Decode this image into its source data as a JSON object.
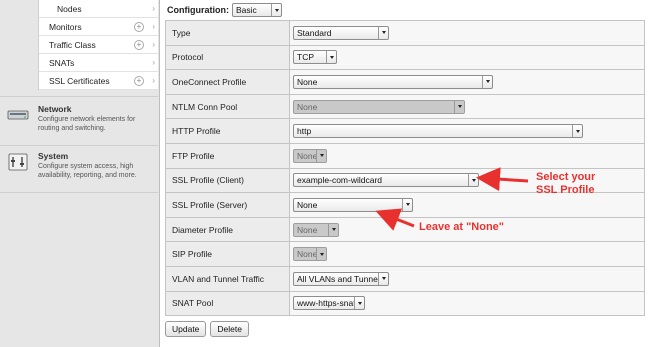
{
  "sidebar": {
    "submenu": [
      {
        "label": "Nodes",
        "indented": true,
        "has_add": false
      },
      {
        "label": "Monitors",
        "indented": false,
        "has_add": true
      },
      {
        "label": "Traffic Class",
        "indented": false,
        "has_add": true
      },
      {
        "label": "SNATs",
        "indented": false,
        "has_add": false
      },
      {
        "label": "SSL Certificates",
        "indented": false,
        "has_add": true
      }
    ],
    "network": {
      "title": "Network",
      "description": "Configure network elements for routing and switching."
    },
    "system": {
      "title": "System",
      "description": "Configure system access, high availability, reporting, and more."
    }
  },
  "configuration": {
    "label": "Configuration:",
    "value": "Basic"
  },
  "settings": [
    {
      "label": "Type",
      "value": "Standard",
      "width": "wide-s",
      "disabled": false
    },
    {
      "label": "Protocol",
      "value": "TCP",
      "disabled": false
    },
    {
      "label": "OneConnect Profile",
      "value": "None",
      "disabled": false
    },
    {
      "label": "NTLM Conn Pool",
      "value": "None",
      "disabled": true
    },
    {
      "label": "HTTP Profile",
      "value": "http",
      "disabled": false
    },
    {
      "label": "FTP Profile",
      "value": "None",
      "disabled": true
    },
    {
      "label": "SSL Profile (Client)",
      "value": "example-com-wildcard",
      "disabled": false
    },
    {
      "label": "SSL Profile (Server)",
      "value": "None",
      "disabled": false
    },
    {
      "label": "Diameter Profile",
      "value": "None",
      "disabled": true
    },
    {
      "label": "SIP Profile",
      "value": "None",
      "disabled": true
    },
    {
      "label": "VLAN and Tunnel Traffic",
      "value": "All VLANs and Tunnels",
      "disabled": false
    },
    {
      "label": "SNAT Pool",
      "value": "www-https-snat",
      "disabled": false
    }
  ],
  "actions": {
    "update": "Update",
    "delete": "Delete"
  },
  "annotations": {
    "select_ssl": [
      "Select your",
      "SSL Profile"
    ],
    "leave_none": "Leave at \"None\""
  },
  "colors": {
    "annotation": "#e8312f",
    "sidebar_bg": "#e6e6e6",
    "label_bg": "#ececec"
  }
}
